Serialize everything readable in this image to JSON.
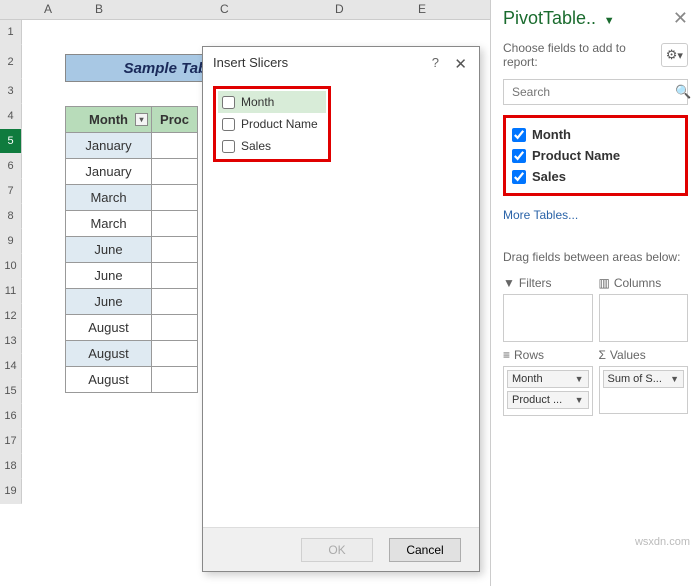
{
  "columns": [
    "A",
    "B",
    "C",
    "D",
    "E"
  ],
  "rows": [
    "1",
    "2",
    "3",
    "4",
    "5",
    "6",
    "7",
    "8",
    "9",
    "10",
    "11",
    "12",
    "13",
    "14",
    "15",
    "16",
    "17",
    "18",
    "19"
  ],
  "selectedRow": "5",
  "title": "Sample Table with a Slicer",
  "table": {
    "headers": [
      "Month",
      "Proc"
    ],
    "data": [
      "January",
      "January",
      "March",
      "March",
      "June",
      "June",
      "June",
      "August",
      "August",
      "August"
    ]
  },
  "dialog": {
    "title": "Insert Slicers",
    "help": "?",
    "close": "✕",
    "items": [
      "Month",
      "Product Name",
      "Sales"
    ],
    "ok": "OK",
    "cancel": "Cancel"
  },
  "panel": {
    "title": "PivotTable..",
    "menu": "▼",
    "close": "✕",
    "sub": "Choose fields to add to report:",
    "searchPlaceholder": "Search",
    "fields": [
      "Month",
      "Product Name",
      "Sales"
    ],
    "more": "More Tables...",
    "dragLabel": "Drag fields between areas below:",
    "areas": {
      "filters": "Filters",
      "columns": "Columns",
      "rowsLbl": "Rows",
      "values": "Values"
    },
    "rowChips": [
      "Month",
      "Product ..."
    ],
    "valueChips": [
      "Sum of S..."
    ]
  },
  "watermark": "wsxdn.com"
}
